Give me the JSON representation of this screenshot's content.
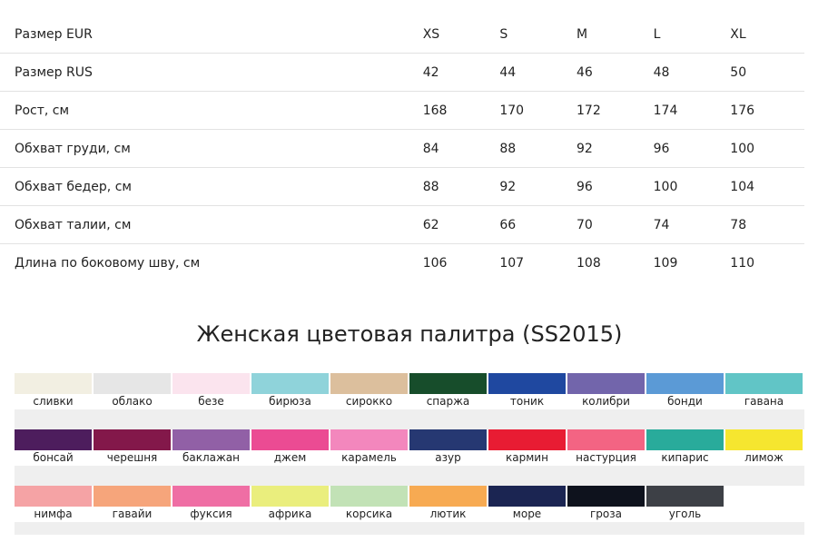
{
  "size_table": {
    "rows": [
      {
        "label": "Размер EUR",
        "values": [
          "XS",
          "S",
          "M",
          "L",
          "XL"
        ]
      },
      {
        "label": "Размер RUS",
        "values": [
          "42",
          "44",
          "46",
          "48",
          "50"
        ]
      },
      {
        "label": "Рост, см",
        "values": [
          "168",
          "170",
          "172",
          "174",
          "176"
        ]
      },
      {
        "label": "Обхват груди, см",
        "values": [
          "84",
          "88",
          "92",
          "96",
          "100"
        ]
      },
      {
        "label": "Обхват бедер, см",
        "values": [
          "88",
          "92",
          "96",
          "100",
          "104"
        ]
      },
      {
        "label": "Обхват талии, см",
        "values": [
          "62",
          "66",
          "70",
          "74",
          "78"
        ]
      },
      {
        "label": "Длина по боковому шву, см",
        "values": [
          "106",
          "107",
          "108",
          "109",
          "110"
        ]
      }
    ]
  },
  "palette": {
    "title": "Женская цветовая палитра (SS2015)",
    "rows": [
      [
        {
          "name": "сливки",
          "color": "#f2efe2"
        },
        {
          "name": "облако",
          "color": "#e6e6e6"
        },
        {
          "name": "безе",
          "color": "#fbe4ee"
        },
        {
          "name": "бирюза",
          "color": "#8fd3da"
        },
        {
          "name": "сирокко",
          "color": "#dcbf9d"
        },
        {
          "name": "спаржа",
          "color": "#174d2b"
        },
        {
          "name": "тоник",
          "color": "#1f48a0"
        },
        {
          "name": "колибри",
          "color": "#7265ab"
        },
        {
          "name": "бонди",
          "color": "#5b9ad6"
        },
        {
          "name": "гавана",
          "color": "#61c5c6"
        }
      ],
      [
        {
          "name": "бонсай",
          "color": "#4d1d5d"
        },
        {
          "name": "черешня",
          "color": "#83184a"
        },
        {
          "name": "баклажан",
          "color": "#9160a6"
        },
        {
          "name": "джем",
          "color": "#eb4b93"
        },
        {
          "name": "карамель",
          "color": "#f387bd"
        },
        {
          "name": "азур",
          "color": "#263872"
        },
        {
          "name": "кармин",
          "color": "#e81c33"
        },
        {
          "name": "настурция",
          "color": "#f36483"
        },
        {
          "name": "кипарис",
          "color": "#29ab9b"
        },
        {
          "name": "лимож",
          "color": "#f6e62f"
        }
      ],
      [
        {
          "name": "нимфа",
          "color": "#f5a3a5"
        },
        {
          "name": "гавайи",
          "color": "#f6a57b"
        },
        {
          "name": "фуксия",
          "color": "#ef6ea4"
        },
        {
          "name": "африка",
          "color": "#eaee7d"
        },
        {
          "name": "корсика",
          "color": "#c2e2b6"
        },
        {
          "name": "лютик",
          "color": "#f7aa52"
        },
        {
          "name": "море",
          "color": "#1b2552"
        },
        {
          "name": "гроза",
          "color": "#0e121d"
        },
        {
          "name": "уголь",
          "color": "#3d4046"
        }
      ]
    ]
  }
}
